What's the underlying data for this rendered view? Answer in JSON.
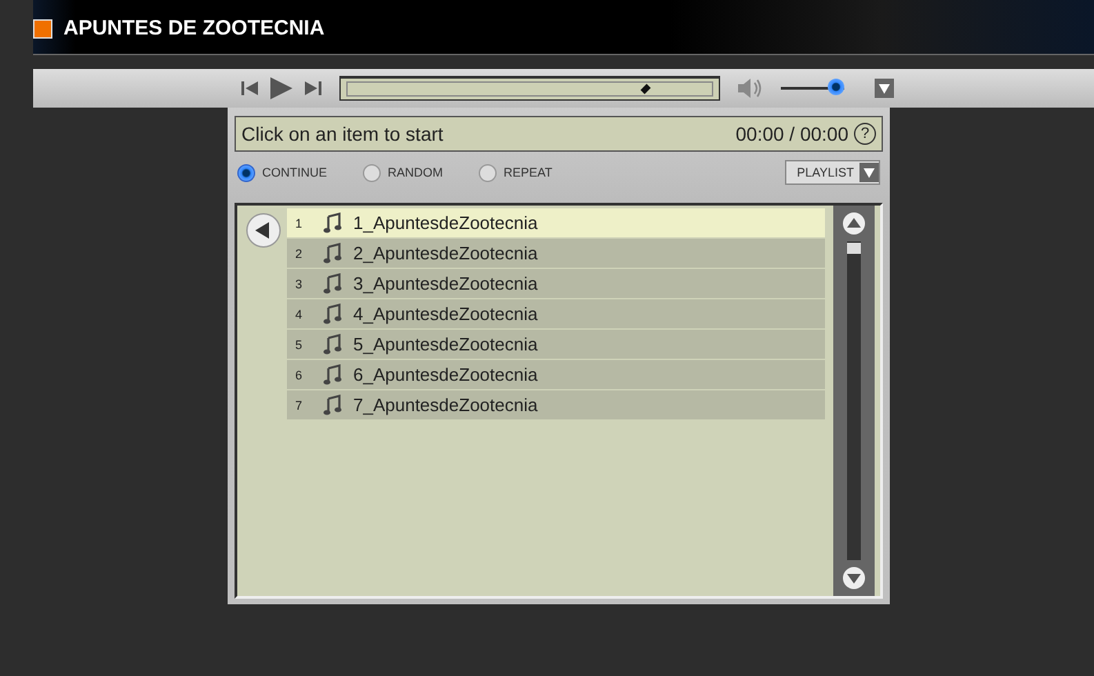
{
  "window": {
    "title": "APUNTES DE ZOOTECNIA"
  },
  "player": {
    "progress": {
      "level": 0.82
    },
    "volume": {
      "level": 0.87
    }
  },
  "status": {
    "message": "Click on an item to start",
    "time": "00:00 / 00:00",
    "help": "?"
  },
  "modes": [
    {
      "label": "CONTINUE",
      "selected": true
    },
    {
      "label": "RANDOM",
      "selected": false
    },
    {
      "label": "REPEAT",
      "selected": false
    }
  ],
  "playlist_button": "PLAYLIST",
  "tracks": [
    {
      "number": "1",
      "title": "1_ApuntesdeZootecnia",
      "selected": true
    },
    {
      "number": "2",
      "title": "2_ApuntesdeZootecnia",
      "selected": false
    },
    {
      "number": "3",
      "title": "3_ApuntesdeZootecnia",
      "selected": false
    },
    {
      "number": "4",
      "title": "4_ApuntesdeZootecnia",
      "selected": false
    },
    {
      "number": "5",
      "title": "5_ApuntesdeZootecnia",
      "selected": false
    },
    {
      "number": "6",
      "title": "6_ApuntesdeZootecnia",
      "selected": false
    },
    {
      "number": "7",
      "title": "7_ApuntesdeZootecnia",
      "selected": false
    }
  ]
}
